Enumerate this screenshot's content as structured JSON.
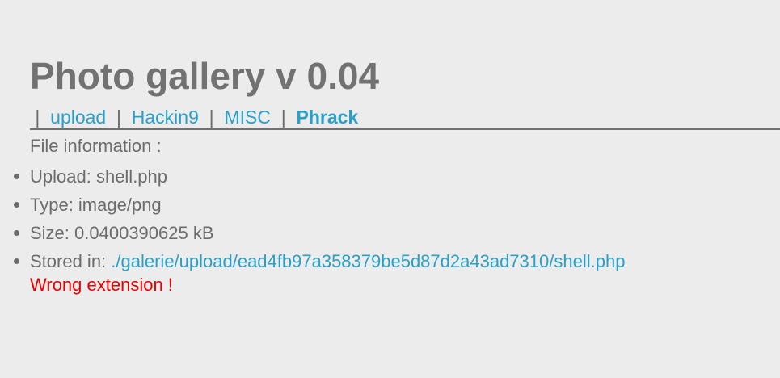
{
  "header": {
    "title": "Photo gallery v 0.04"
  },
  "nav": {
    "separator": "|",
    "links": [
      {
        "label": "upload"
      },
      {
        "label": "Hackin9"
      },
      {
        "label": "MISC"
      },
      {
        "label": "Phrack"
      }
    ]
  },
  "file_info": {
    "heading": "File information :",
    "items": [
      {
        "label": "Upload: ",
        "value": "shell.php"
      },
      {
        "label": "Type: ",
        "value": "image/png"
      },
      {
        "label": "Size: ",
        "value": "0.0400390625 kB"
      },
      {
        "label": "Stored in: ",
        "value": "./galerie/upload/ead4fb97a358379be5d87d2a43ad7310/shell.php"
      }
    ]
  },
  "message": {
    "error": "Wrong extension !"
  },
  "colors": {
    "background": "#ececec",
    "text": "#6c6c6c",
    "link": "#2aa0c8",
    "error": "#e60000"
  }
}
